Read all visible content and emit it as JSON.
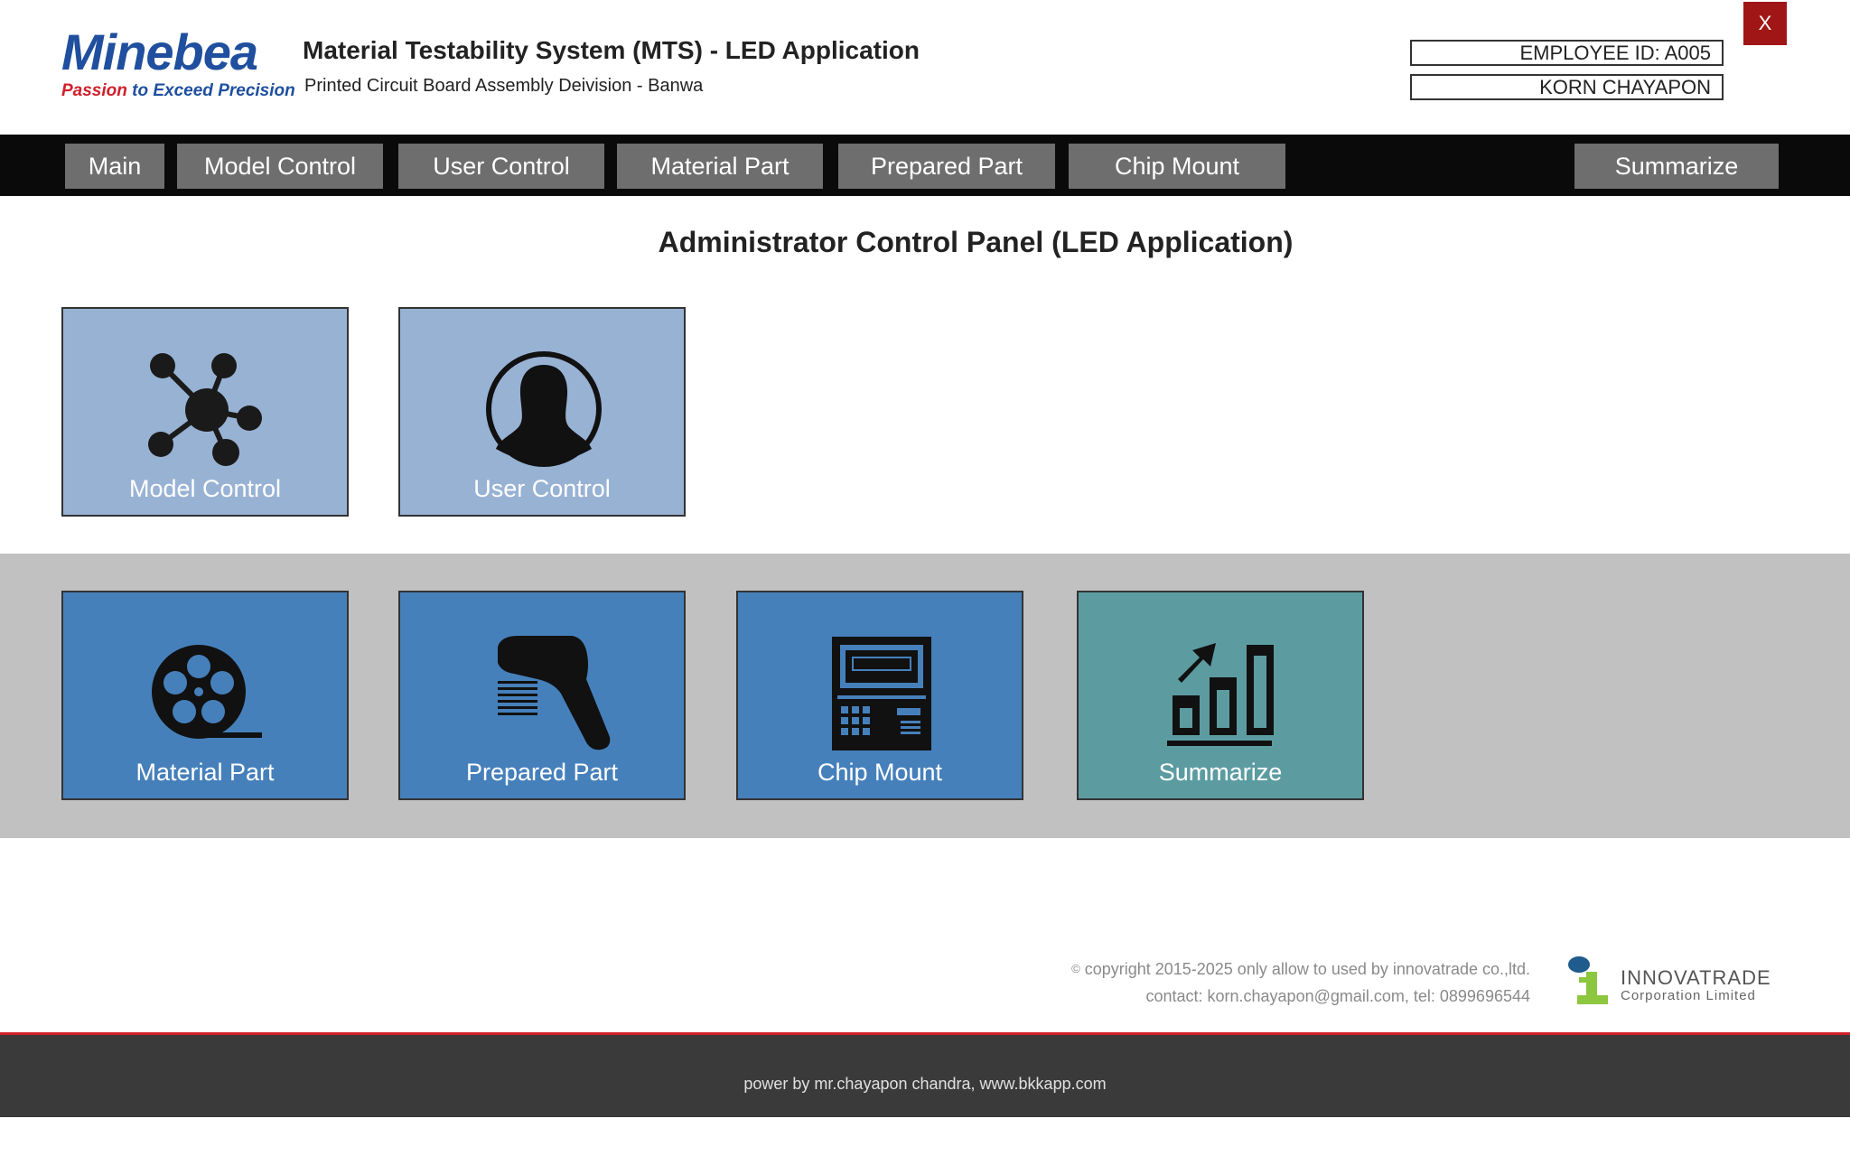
{
  "header": {
    "brand_name": "Minebea",
    "brand_tagline_red": "Passion",
    "brand_tagline_blue": "to Exceed Precision",
    "title": "Material Testability System (MTS) - LED Application",
    "subtitle": "Printed Circuit Board Assembly Deivision - Banwa",
    "employee_id": "EMPLOYEE ID: A005",
    "user_name": "KORN CHAYAPON",
    "close_label": "X"
  },
  "nav": {
    "items": [
      {
        "label": "Main"
      },
      {
        "label": "Model Control"
      },
      {
        "label": "User Control"
      },
      {
        "label": "Material Part"
      },
      {
        "label": "Prepared Part"
      },
      {
        "label": "Chip Mount"
      },
      {
        "label": "Summarize"
      }
    ]
  },
  "main": {
    "panel_title": "Administrator Control Panel (LED Application)",
    "tiles": [
      {
        "label": "Model Control",
        "icon": "network-hub-icon"
      },
      {
        "label": "User Control",
        "icon": "user-avatar-icon"
      },
      {
        "label": "Material Part",
        "icon": "film-reel-icon"
      },
      {
        "label": "Prepared Part",
        "icon": "barcode-scanner-icon"
      },
      {
        "label": "Chip Mount",
        "icon": "chip-mount-machine-icon"
      },
      {
        "label": "Summarize",
        "icon": "bar-chart-growth-icon"
      }
    ]
  },
  "footer": {
    "copyright_line1": "copyright 2015-2025 only allow to used by innovatrade co.,ltd.",
    "copyright_line2": "contact: korn.chayapon@gmail.com, tel: 0899696544",
    "company_name": "INNOVATRADE",
    "company_sub": "Corporation Limited",
    "power_text": "power by mr.chayapon chandra, www.bkkapp.com"
  },
  "colors": {
    "brand_blue": "#1f4f9e",
    "brand_red": "#d0202b",
    "nav_bg": "#0a0a0a",
    "nav_button": "#6e6e6e",
    "tile_light": "#98b2d4",
    "tile_blue": "#4680bb",
    "tile_teal": "#5c9ca1",
    "close_button": "#a01616",
    "band_grey": "#c1c1c1",
    "footer_bg": "#3a3a3a"
  }
}
